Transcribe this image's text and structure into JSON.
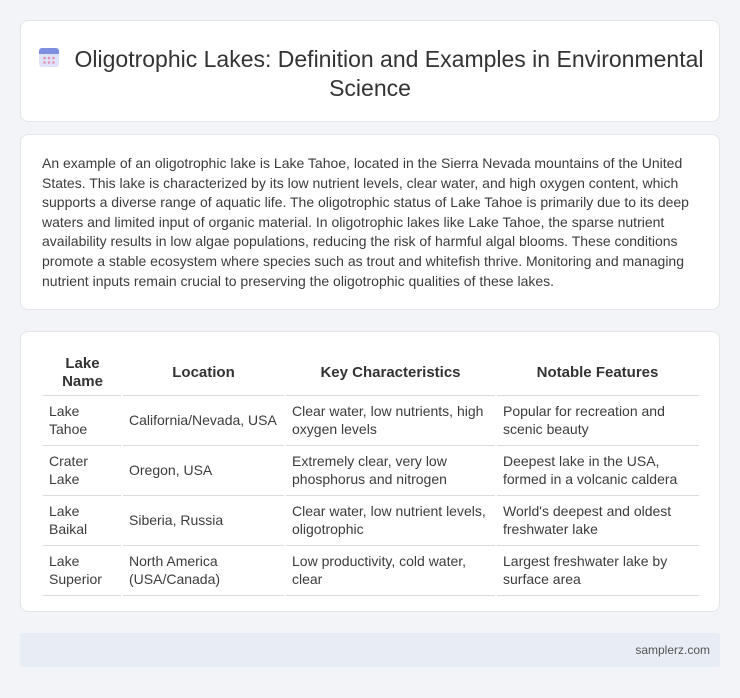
{
  "header": {
    "title": "Oligotrophic Lakes: Definition and Examples in Environmental Science",
    "icon": "calendar-icon"
  },
  "intro": {
    "text": "An example of an oligotrophic lake is Lake Tahoe, located in the Sierra Nevada mountains of the United States. This lake is characterized by its low nutrient levels, clear water, and high oxygen content, which supports a diverse range of aquatic life. The oligotrophic status of Lake Tahoe is primarily due to its deep waters and limited input of organic material. In oligotrophic lakes like Lake Tahoe, the sparse nutrient availability results in low algae populations, reducing the risk of harmful algal blooms. These conditions promote a stable ecosystem where species such as trout and whitefish thrive. Monitoring and managing nutrient inputs remain crucial to preserving the oligotrophic qualities of these lakes."
  },
  "table": {
    "headers": [
      "Lake Name",
      "Location",
      "Key Characteristics",
      "Notable Features"
    ],
    "rows": [
      [
        "Lake Tahoe",
        "California/Nevada, USA",
        "Clear water, low nutrients, high oxygen levels",
        "Popular for recreation and scenic beauty"
      ],
      [
        "Crater Lake",
        "Oregon, USA",
        "Extremely clear, very low phosphorus and nitrogen",
        "Deepest lake in the USA, formed in a volcanic caldera"
      ],
      [
        "Lake Baikal",
        "Siberia, Russia",
        "Clear water, low nutrient levels, oligotrophic",
        "World's deepest and oldest freshwater lake"
      ],
      [
        "Lake Superior",
        "North America (USA/Canada)",
        "Low productivity, cold water, clear",
        "Largest freshwater lake by surface area"
      ]
    ]
  },
  "footer": {
    "site": "samplerz.com"
  }
}
